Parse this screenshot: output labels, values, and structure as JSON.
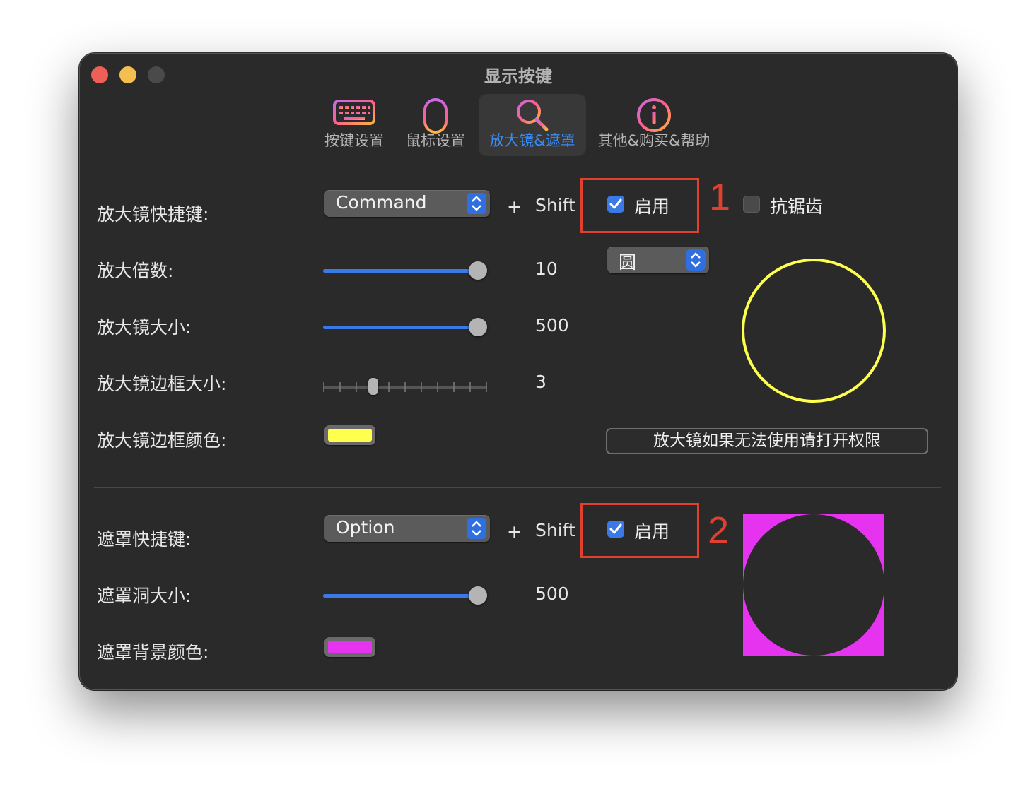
{
  "window": {
    "title": "显示按键"
  },
  "tabs": [
    {
      "label": "按键设置",
      "icon": "keyboard-icon"
    },
    {
      "label": "鼠标设置",
      "icon": "mouse-icon"
    },
    {
      "label": "放大镜&遮罩",
      "icon": "magnifier-icon",
      "active": true
    },
    {
      "label": "其他&购买&帮助",
      "icon": "info-icon"
    }
  ],
  "magnifier": {
    "shortcut_label": "放大镜快捷键:",
    "modifier": "Command",
    "plus": "+",
    "shift": "Shift",
    "enable_label": "启用",
    "enabled": true,
    "antialias_label": "抗锯齿",
    "antialias": false,
    "zoom_label": "放大倍数:",
    "zoom_value": "10",
    "size_label": "放大镜大小:",
    "size_value": "500",
    "border_size_label": "放大镜边框大小:",
    "border_size_value": "3",
    "border_color_label": "放大镜边框颜色:",
    "border_color": "#ffff4d",
    "shape": "圆",
    "permission_button": "放大镜如果无法使用请打开权限"
  },
  "mask": {
    "shortcut_label": "遮罩快捷键:",
    "modifier": "Option",
    "plus": "+",
    "shift": "Shift",
    "enable_label": "启用",
    "enabled": true,
    "hole_size_label": "遮罩洞大小:",
    "hole_size_value": "500",
    "bg_color_label": "遮罩背景颜色:",
    "bg_color": "#e633f0"
  },
  "annotations": {
    "one": "1",
    "two": "2"
  },
  "colors": {
    "accent": "#3b79e6",
    "annotation_red": "#e0402e"
  }
}
